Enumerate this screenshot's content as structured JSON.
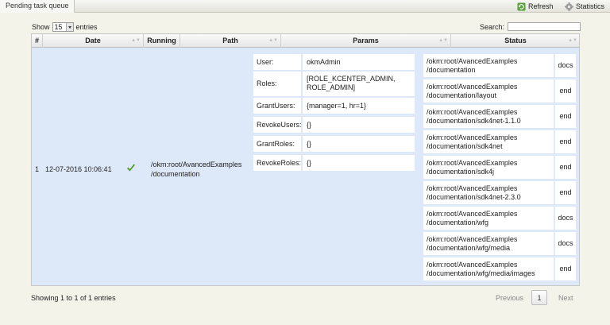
{
  "tab": {
    "label": "Pending task queue"
  },
  "toolbar": {
    "refresh_label": "Refresh",
    "statistics_label": "Statistics"
  },
  "length": {
    "show_label": "Show",
    "value": "15",
    "entries_label": "entries"
  },
  "search": {
    "label": "Search:",
    "value": ""
  },
  "table": {
    "columns": [
      "#",
      "Date",
      "Running",
      "Path",
      "Params",
      "Status"
    ],
    "row": {
      "index": "1",
      "date": "12-07-2016 10:06:41",
      "path_line1": "/okm:root/AvancedExamples",
      "path_line2": "/documentation",
      "params": [
        {
          "key": "User:",
          "value": "okmAdmin"
        },
        {
          "key": "Roles:",
          "value": "[ROLE_KCENTER_ADMIN,",
          "value2": "ROLE_ADMIN]"
        },
        {
          "key": "GrantUsers:",
          "value": "{manager=1, hr=1}"
        },
        {
          "key": "RevokeUsers:",
          "value": "{}"
        },
        {
          "key": "GrantRoles:",
          "value": "{}"
        },
        {
          "key": "RevokeRoles:",
          "value": "{}"
        }
      ],
      "status": [
        {
          "l1": "/okm:root/AvancedExamples",
          "l2": "/documentation",
          "s": "docs"
        },
        {
          "l1": "/okm:root/AvancedExamples",
          "l2": "/documentation/layout",
          "s": "end"
        },
        {
          "l1": "/okm:root/AvancedExamples",
          "l2": "/documentation/sdk4net-1.1.0",
          "s": "end"
        },
        {
          "l1": "/okm:root/AvancedExamples",
          "l2": "/documentation/sdk4net",
          "s": "end"
        },
        {
          "l1": "/okm:root/AvancedExamples",
          "l2": "/documentation/sdk4j",
          "s": "end"
        },
        {
          "l1": "/okm:root/AvancedExamples",
          "l2": "/documentation/sdk4net-2.3.0",
          "s": "end"
        },
        {
          "l1": "/okm:root/AvancedExamples",
          "l2": "/documentation/wfg",
          "s": "docs"
        },
        {
          "l1": "/okm:root/AvancedExamples",
          "l2": "/documentation/wfg/media",
          "s": "docs"
        },
        {
          "l1": "/okm:root/AvancedExamples",
          "l2": "/documentation/wfg/media/images",
          "s": "end"
        }
      ]
    }
  },
  "footer": {
    "info": "Showing 1 to 1 of 1 entries",
    "previous": "Previous",
    "page": "1",
    "next": "Next"
  },
  "colors": {
    "row_bg": "#dde8f8",
    "check": "#4c9a2a",
    "refresh_icon": "#3d8a2a"
  }
}
